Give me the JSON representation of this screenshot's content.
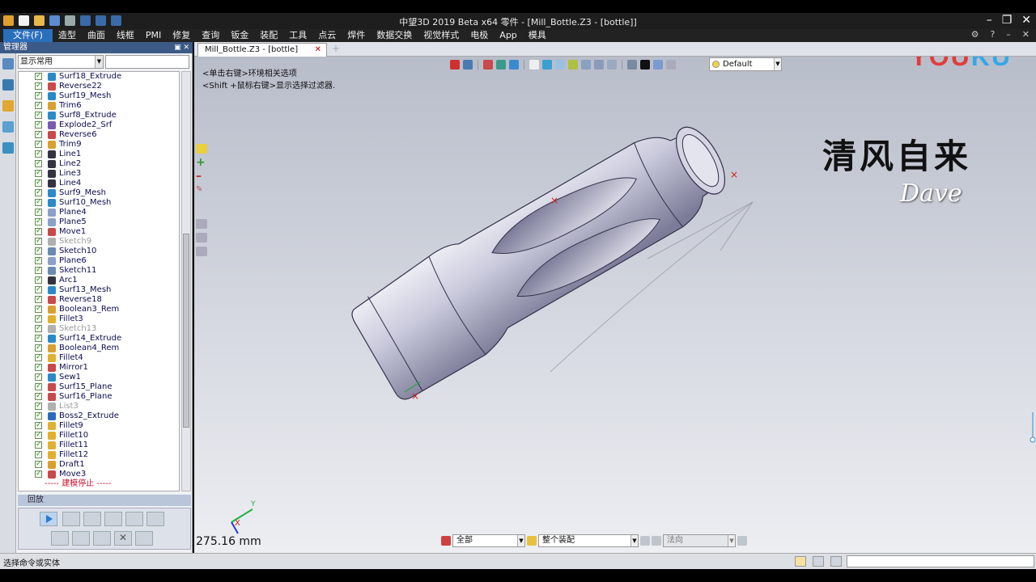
{
  "titlebar": {
    "title": "中望3D 2019 Beta x64        零件 - [Mill_Bottle.Z3 - [bottle]]"
  },
  "menu": [
    "文件(F)",
    "造型",
    "曲面",
    "线框",
    "PMI",
    "修复",
    "查询",
    "钣金",
    "装配",
    "工具",
    "点云",
    "焊件",
    "数据交换",
    "视觉样式",
    "电极",
    "App",
    "模具"
  ],
  "manager": {
    "title": "管理器",
    "filter": "显示常用",
    "tree": [
      {
        "label": "Surf18_Extrude",
        "icon_color": "#2a8ac8",
        "dim": false
      },
      {
        "label": "Reverse22",
        "icon_color": "#c84a4a",
        "dim": false
      },
      {
        "label": "Surf19_Mesh",
        "icon_color": "#2a8ac8",
        "dim": false
      },
      {
        "label": "Trim6",
        "icon_color": "#d8a030",
        "dim": false
      },
      {
        "label": "Surf8_Extrude",
        "icon_color": "#2a8ac8",
        "dim": false
      },
      {
        "label": "Explode2_Srf",
        "icon_color": "#7a5ab0",
        "dim": false
      },
      {
        "label": "Reverse6",
        "icon_color": "#c84a4a",
        "dim": false
      },
      {
        "label": "Trim9",
        "icon_color": "#d8a030",
        "dim": false
      },
      {
        "label": "Line1",
        "icon_color": "#334",
        "dim": false
      },
      {
        "label": "Line2",
        "icon_color": "#334",
        "dim": false
      },
      {
        "label": "Line3",
        "icon_color": "#334",
        "dim": false
      },
      {
        "label": "Line4",
        "icon_color": "#334",
        "dim": false
      },
      {
        "label": "Surf9_Mesh",
        "icon_color": "#2a8ac8",
        "dim": false
      },
      {
        "label": "Surf10_Mesh",
        "icon_color": "#2a8ac8",
        "dim": false
      },
      {
        "label": "Plane4",
        "icon_color": "#8aa0c8",
        "dim": false
      },
      {
        "label": "Plane5",
        "icon_color": "#8aa0c8",
        "dim": false
      },
      {
        "label": "Move1",
        "icon_color": "#c84a4a",
        "dim": false
      },
      {
        "label": "Sketch9",
        "icon_color": "#b0b0b0",
        "dim": true
      },
      {
        "label": "Sketch10",
        "icon_color": "#6a8ab0",
        "dim": false
      },
      {
        "label": "Plane6",
        "icon_color": "#8aa0c8",
        "dim": false
      },
      {
        "label": "Sketch11",
        "icon_color": "#6a8ab0",
        "dim": false
      },
      {
        "label": "Arc1",
        "icon_color": "#334",
        "dim": false
      },
      {
        "label": "Surf13_Mesh",
        "icon_color": "#2a8ac8",
        "dim": false
      },
      {
        "label": "Reverse18",
        "icon_color": "#c84a4a",
        "dim": false
      },
      {
        "label": "Boolean3_Rem",
        "icon_color": "#d8a030",
        "dim": false
      },
      {
        "label": "Fillet3",
        "icon_color": "#e0b030",
        "dim": false
      },
      {
        "label": "Sketch13",
        "icon_color": "#b0b0b0",
        "dim": true
      },
      {
        "label": "Surf14_Extrude",
        "icon_color": "#2a8ac8",
        "dim": false
      },
      {
        "label": "Boolean4_Rem",
        "icon_color": "#d8a030",
        "dim": false
      },
      {
        "label": "Fillet4",
        "icon_color": "#e0b030",
        "dim": false
      },
      {
        "label": "Mirror1",
        "icon_color": "#c84a4a",
        "dim": false
      },
      {
        "label": "Sew1",
        "icon_color": "#2a8ac8",
        "dim": false
      },
      {
        "label": "Surf15_Plane",
        "icon_color": "#c84a4a",
        "dim": false
      },
      {
        "label": "Surf16_Plane",
        "icon_color": "#c84a4a",
        "dim": false
      },
      {
        "label": "List3",
        "icon_color": "#b0b0b0",
        "dim": true
      },
      {
        "label": "Boss2_Extrude",
        "icon_color": "#2a6ab8",
        "dim": false
      },
      {
        "label": "Fillet9",
        "icon_color": "#e0b030",
        "dim": false
      },
      {
        "label": "Fillet10",
        "icon_color": "#e0b030",
        "dim": false
      },
      {
        "label": "Fillet11",
        "icon_color": "#e0b030",
        "dim": false
      },
      {
        "label": "Fillet12",
        "icon_color": "#e0b030",
        "dim": false
      },
      {
        "label": "Draft1",
        "icon_color": "#d8a030",
        "dim": false
      },
      {
        "label": "Move3",
        "icon_color": "#c84a4a",
        "dim": false
      }
    ],
    "stop_label": "----- 建模停止 -----",
    "replay_title": "回放"
  },
  "doc_tab": "Mill_Bottle.Z3 - [bottle]",
  "view": {
    "style_select": "Default",
    "hint1": "<单击右键>环境相关选项",
    "hint2": "<Shift +鼠标右键>显示选择过滤器.",
    "watermark_a": "YOU",
    "watermark_b": "KU",
    "calligraphy": "清风自来",
    "signature": "Dave",
    "dimension": "275.16 mm",
    "filter_all": "全部",
    "filter_assembly": "整个装配",
    "normal_field": "法向"
  },
  "status": {
    "message": "选择命令或实体"
  }
}
